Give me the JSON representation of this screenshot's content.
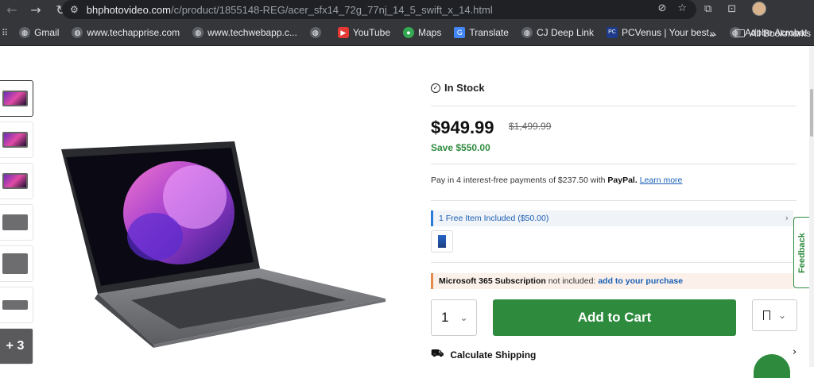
{
  "browser": {
    "url_host": "bhphotovideo.com",
    "url_path": "/c/product/1855148-REG/acer_sfx14_72g_77nj_14_5_swift_x_14.html",
    "icons": [
      "back-icon",
      "forward-icon",
      "reload-icon",
      "site-settings-icon",
      "eye-off-icon",
      "star-icon",
      "extensions-icon",
      "tab-search-icon",
      "profile-avatar"
    ]
  },
  "bookmarks": {
    "items": [
      {
        "label": "Gmail",
        "icon": "globe-icon"
      },
      {
        "label": "www.techapprise.com",
        "icon": "globe-icon"
      },
      {
        "label": "www.techwebapp.c...",
        "icon": "globe-icon"
      },
      {
        "label": "",
        "icon": "globe-icon"
      },
      {
        "label": "YouTube",
        "icon": "youtube-icon"
      },
      {
        "label": "Maps",
        "icon": "maps-icon"
      },
      {
        "label": "Translate",
        "icon": "translate-icon"
      },
      {
        "label": "CJ Deep Link",
        "icon": "globe-icon"
      },
      {
        "label": "PCVenus | Your best...",
        "icon": "pc-icon"
      },
      {
        "label": "Adobe Acrobat",
        "icon": "globe-icon"
      }
    ],
    "overflow": "»",
    "all_label": "All Bookmarks"
  },
  "gallery": {
    "more_label": "+ 3"
  },
  "product": {
    "stock": "In Stock",
    "price": "$949.99",
    "original_price": "$1,499.99",
    "savings": "Save $550.00",
    "paypal_text": "Pay in 4 interest-free payments of $237.50 with",
    "paypal_brand": "PayPal.",
    "paypal_link": "Learn more",
    "free_item": "1 Free Item Included ($50.00)",
    "ms_title": "Microsoft 365 Subscription",
    "ms_text": "not included:",
    "ms_link": "add to your purchase",
    "quantity": "1",
    "add_to_cart": "Add to Cart",
    "shipping": "Calculate Shipping"
  },
  "feedback_label": "Feedback",
  "colors": {
    "accent_green": "#2e8b3e",
    "link_blue": "#1a5fb4",
    "chrome_dark": "#35363a"
  }
}
